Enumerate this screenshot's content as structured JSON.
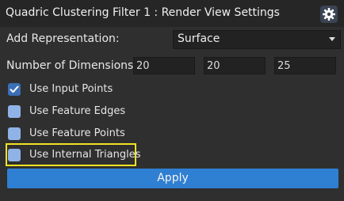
{
  "window": {
    "title": "Quadric Clustering Filter 1 : Render View Settings",
    "settings_icon": "gear-icon"
  },
  "representation": {
    "label": "Add Representation:",
    "value": "Surface"
  },
  "dimensions": {
    "label": "Number of Dimensions :",
    "values": [
      "20",
      "20",
      "25"
    ]
  },
  "options": [
    {
      "label": "Use Input Points",
      "checked": true
    },
    {
      "label": "Use Feature Edges",
      "checked": false
    },
    {
      "label": "Use Feature Points",
      "checked": false
    },
    {
      "label": "Use Internal Triangles",
      "checked": false
    }
  ],
  "highlight_color": "#f0e322",
  "apply": {
    "label": "Apply"
  }
}
